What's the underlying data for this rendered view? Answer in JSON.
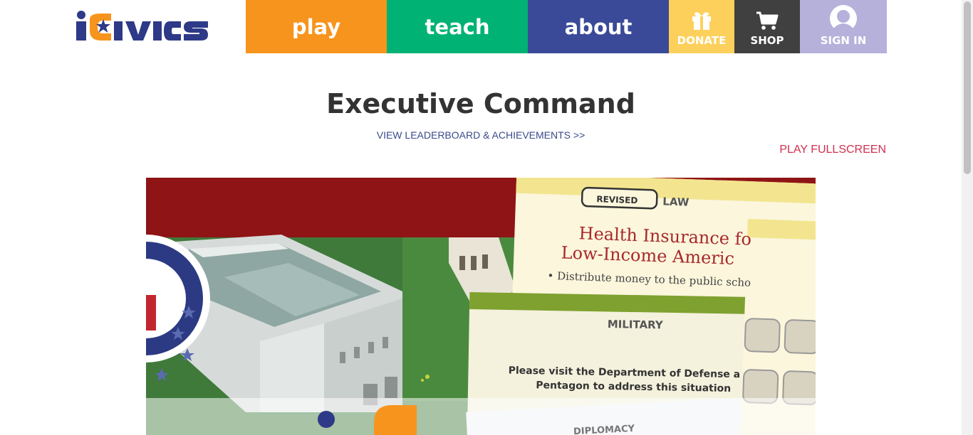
{
  "header": {
    "logo_text": "iCivics",
    "nav": {
      "play": "play",
      "teach": "teach",
      "about": "about",
      "donate": "DONATE",
      "shop": "SHOP",
      "sign_in": "SIGN IN"
    }
  },
  "main": {
    "title": "Executive Command",
    "leaderboard_link": "VIEW LEADERBOARD & ACHIEVEMENTS >>",
    "fullscreen_link": "PLAY FULLSCREEN"
  },
  "game": {
    "card_law": {
      "stamp": "REVISED",
      "category": "LAW",
      "title_line1": "Health Insurance fo",
      "title_line2": "Low-Income Americ",
      "bullet": "• Distribute money to the public scho"
    },
    "card_military": {
      "category": "MILITARY",
      "text_line1": "Please visit the Department of Defense a",
      "text_line2": "Pentagon to address this situation"
    },
    "card_diplomacy": {
      "category": "DIPLOMACY"
    }
  },
  "colors": {
    "play": "#f7941d",
    "teach": "#00b274",
    "about": "#3a4a98",
    "donate": "#fdd05b",
    "shop": "#404040",
    "sign_in": "#b5b1db",
    "title": "#333333",
    "fullscreen": "#d0304f",
    "link": "#3a4a8c"
  }
}
